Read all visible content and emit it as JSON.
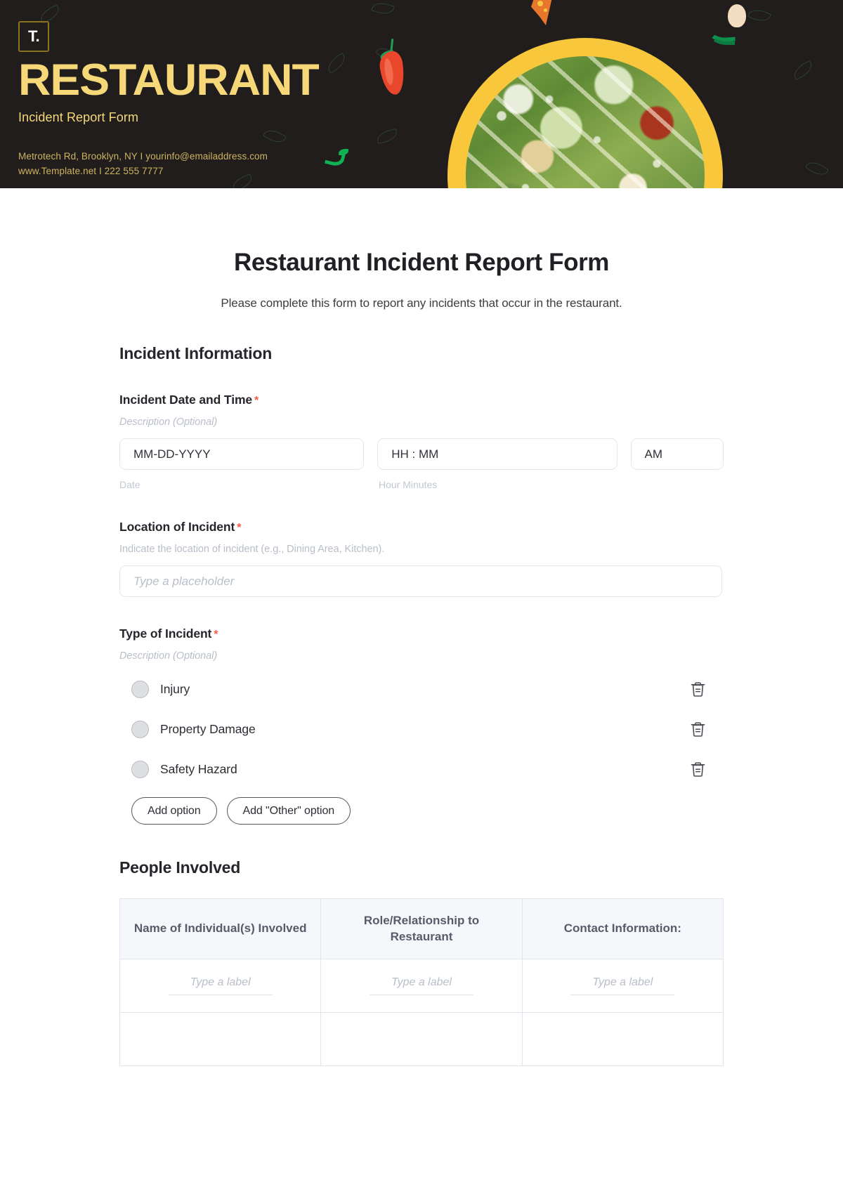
{
  "banner": {
    "logo_text": "T.",
    "brand_title": "RESTAURANT",
    "brand_subtitle": "Incident Report Form",
    "contact_line_1": "Metrotech Rd, Brooklyn, NY  I  yourinfo@emailaddress.com",
    "contact_line_2": "www.Template.net  I  222 555 7777",
    "background_color": "#221d1d",
    "accent_color": "#f6d878",
    "plate_ring_color": "#f8c73c"
  },
  "form": {
    "title": "Restaurant Incident Report Form",
    "description": "Please complete this form to report any incidents that occur in the restaurant.",
    "required_marker": "*",
    "required_color": "#f9593f"
  },
  "sections": {
    "incident_information": {
      "heading": "Incident Information",
      "date_time": {
        "label": "Incident Date and Time",
        "hint": "Description (Optional)",
        "date_placeholder": "MM-DD-YYYY",
        "time_placeholder": "HH : MM",
        "ampm_value": "AM",
        "date_sublabel": "Date",
        "time_sublabel": "Hour Minutes"
      },
      "location": {
        "label": "Location of Incident",
        "hint": "Indicate the location of incident (e.g., Dining Area, Kitchen).",
        "placeholder": "Type a placeholder"
      },
      "type_of_incident": {
        "label": "Type of Incident",
        "hint": "Description (Optional)",
        "options": [
          {
            "label": "Injury"
          },
          {
            "label": "Property Damage"
          },
          {
            "label": "Safety Hazard"
          }
        ],
        "add_option_label": "Add option",
        "add_other_option_label": "Add \"Other\" option",
        "delete_icon_name": "trash-icon"
      }
    },
    "people_involved": {
      "heading": "People Involved",
      "columns": [
        "Name of Individual(s) Involved",
        "Role/Relationship to Restaurant",
        "Contact Information:"
      ],
      "row_placeholder": "Type a label",
      "rows": [
        [
          "Type a label",
          "Type a label",
          "Type a label"
        ],
        [
          "",
          "",
          ""
        ]
      ],
      "border_color": "#8c8cf0"
    }
  }
}
